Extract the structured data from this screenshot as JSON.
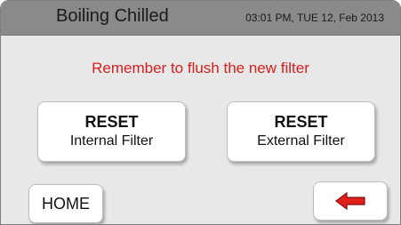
{
  "header": {
    "title": "Boiling Chilled",
    "datetime": "03:01 PM, TUE 12, Feb 2013"
  },
  "message": "Remember to flush the new filter",
  "buttons": {
    "reset_internal": {
      "line1": "RESET",
      "line2": "Internal Filter"
    },
    "reset_external": {
      "line1": "RESET",
      "line2": "External Filter"
    },
    "home": "HOME",
    "back_icon": "left-arrow-icon"
  },
  "colors": {
    "message": "#d62020",
    "arrow": "#e0201c",
    "titlebar": "#8a8a8a",
    "background": "#e8e8e8"
  }
}
